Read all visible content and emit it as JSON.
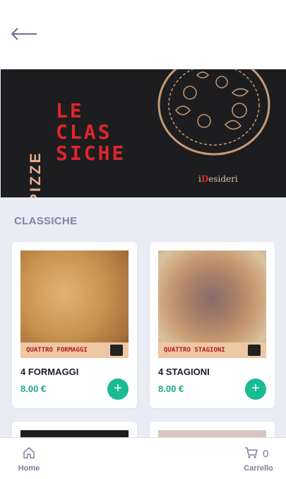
{
  "header": {
    "back_icon": "arrow-left-icon"
  },
  "banner": {
    "vertical_word": "PIZZE",
    "title_lines": [
      "LE",
      "CLAS",
      "SICHE"
    ],
    "brand_prefix": "i",
    "brand_mark": "D",
    "brand_name": "esideri",
    "colors": {
      "background": "#1d1d1f",
      "title": "#e0262b",
      "accent": "#e8ad93"
    }
  },
  "section": {
    "title": "CLASSICHE"
  },
  "products": [
    {
      "name": "4 FORMAGGI",
      "price": "8.00 €",
      "image_label": "QUATTRO FORMAGGI",
      "add_icon": "plus-icon"
    },
    {
      "name": "4 STAGIONI",
      "price": "8.00 €",
      "image_label": "QUATTRO STAGIONI",
      "add_icon": "plus-icon"
    }
  ],
  "tabbar": {
    "home": {
      "label": "Home",
      "icon": "home-icon"
    },
    "cart": {
      "label": "Carrello",
      "icon": "cart-icon",
      "count": "0"
    }
  },
  "colors": {
    "accent": "#1abb94",
    "price": "#1aa88d",
    "muted": "#7f85a3"
  }
}
